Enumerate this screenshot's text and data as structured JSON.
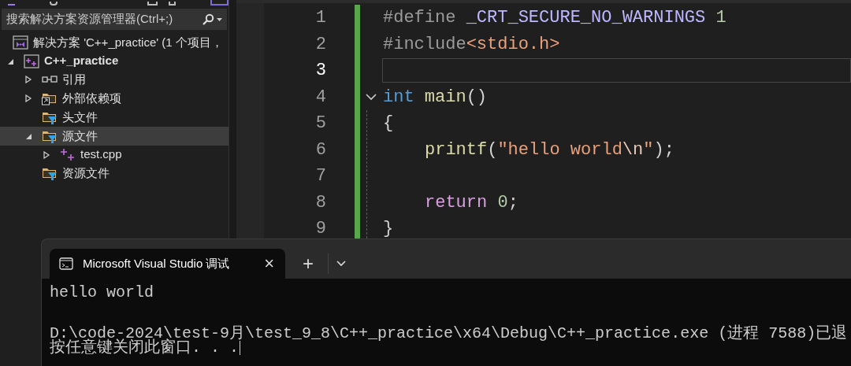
{
  "solution_explorer": {
    "search": {
      "placeholder": "搜索解决方案资源管理器(Ctrl+;)"
    },
    "tree": [
      {
        "kind": "solution",
        "label": "解决方案 'C++_practice' (1 个项目，",
        "selected": false,
        "children": [
          {
            "kind": "project",
            "label": "C++_practice",
            "expanded": true,
            "selected": false,
            "children": [
              {
                "kind": "references",
                "label": "引用",
                "expanded": false,
                "selected": false
              },
              {
                "kind": "external",
                "label": "外部依赖项",
                "expanded": false,
                "selected": false
              },
              {
                "kind": "filter",
                "label": "头文件",
                "selected": false
              },
              {
                "kind": "filter",
                "label": "源文件",
                "expanded": true,
                "selected": true,
                "children": [
                  {
                    "kind": "cpp",
                    "label": "test.cpp",
                    "expanded": false,
                    "selected": false
                  }
                ]
              },
              {
                "kind": "filter",
                "label": "资源文件",
                "selected": false
              }
            ]
          }
        ]
      }
    ]
  },
  "editor": {
    "lines": [
      {
        "number": "1",
        "current": false,
        "tokens": [
          {
            "kind": "preprocessor",
            "text": "#define "
          },
          {
            "kind": "macro",
            "text": "_CRT_SECURE_NO_WARNINGS "
          },
          {
            "kind": "number",
            "text": "1"
          }
        ]
      },
      {
        "number": "2",
        "current": false,
        "tokens": [
          {
            "kind": "preprocessor",
            "text": "#include"
          },
          {
            "kind": "string",
            "text": "<stdio.h>"
          }
        ]
      },
      {
        "number": "3",
        "current": true
      },
      {
        "number": "4",
        "current": false,
        "foldable": true,
        "tokens": [
          {
            "kind": "keyword",
            "text": "int "
          },
          {
            "kind": "function",
            "text": "main"
          },
          {
            "kind": "plain",
            "text": "()"
          }
        ]
      },
      {
        "number": "5",
        "current": false,
        "tokens": [
          {
            "kind": "plain",
            "text": "{"
          }
        ]
      },
      {
        "number": "6",
        "current": false,
        "indented": true,
        "tokens": [
          {
            "kind": "function",
            "text": "printf"
          },
          {
            "kind": "plain",
            "text": "("
          },
          {
            "kind": "string",
            "text": "\"hello world"
          },
          {
            "kind": "escape",
            "text": "\\n"
          },
          {
            "kind": "string",
            "text": "\""
          },
          {
            "kind": "plain",
            "text": ");"
          }
        ]
      },
      {
        "number": "7",
        "current": false
      },
      {
        "number": "8",
        "current": false,
        "indented": true,
        "tokens": [
          {
            "kind": "control",
            "text": "return "
          },
          {
            "kind": "number",
            "text": "0"
          },
          {
            "kind": "plain",
            "text": ";"
          }
        ]
      },
      {
        "number": "9",
        "current": false,
        "tokens": [
          {
            "kind": "plain",
            "text": "}"
          }
        ]
      }
    ]
  },
  "terminal": {
    "tabs": [
      {
        "title": "Microsoft Visual Studio 调试",
        "selected": true,
        "close": "×"
      }
    ],
    "new_tab": "+",
    "output": [
      [
        "hello world"
      ],
      [
        "D:\\code-2024\\test-9月\\test_9_8\\C++_practice\\x64\\Debug\\C++_practice.exe (进程 7588)已退",
        "按任意键关闭此窗口. . ."
      ]
    ]
  }
}
